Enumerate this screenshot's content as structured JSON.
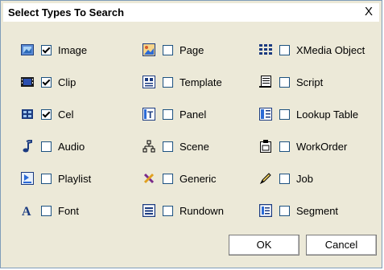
{
  "dialog": {
    "title": "Select Types To Search",
    "close_label": "X"
  },
  "types": [
    {
      "label": "Image",
      "checked": true,
      "icon": "image-icon"
    },
    {
      "label": "Clip",
      "checked": true,
      "icon": "clip-icon"
    },
    {
      "label": "Cel",
      "checked": true,
      "icon": "cel-icon"
    },
    {
      "label": "Audio",
      "checked": false,
      "icon": "audio-icon"
    },
    {
      "label": "Playlist",
      "checked": false,
      "icon": "playlist-icon"
    },
    {
      "label": "Font",
      "checked": false,
      "icon": "font-icon"
    },
    {
      "label": "Page",
      "checked": false,
      "icon": "page-icon"
    },
    {
      "label": "Template",
      "checked": false,
      "icon": "template-icon"
    },
    {
      "label": "Panel",
      "checked": false,
      "icon": "panel-icon"
    },
    {
      "label": "Scene",
      "checked": false,
      "icon": "scene-icon"
    },
    {
      "label": "Generic",
      "checked": false,
      "icon": "generic-icon"
    },
    {
      "label": "Rundown",
      "checked": false,
      "icon": "rundown-icon"
    },
    {
      "label": "XMedia Object",
      "checked": false,
      "icon": "xmedia-object-icon"
    },
    {
      "label": "Script",
      "checked": false,
      "icon": "script-icon"
    },
    {
      "label": "Lookup Table",
      "checked": false,
      "icon": "lookup-table-icon"
    },
    {
      "label": "WorkOrder",
      "checked": false,
      "icon": "workorder-icon"
    },
    {
      "label": "Job",
      "checked": false,
      "icon": "job-icon"
    },
    {
      "label": "Segment",
      "checked": false,
      "icon": "segment-icon"
    }
  ],
  "buttons": {
    "ok_label": "OK",
    "cancel_label": "Cancel"
  },
  "colors": {
    "dialog_background": "#ece9d8",
    "checkbox_border": "#1c5180"
  }
}
